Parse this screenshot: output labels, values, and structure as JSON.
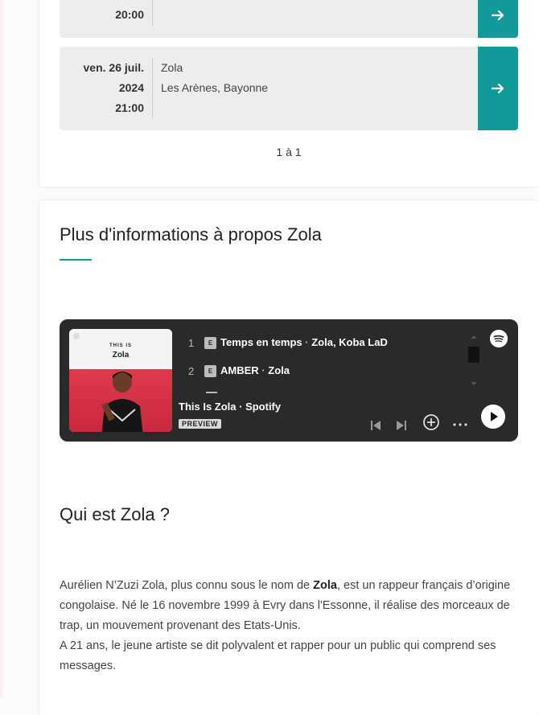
{
  "events": [
    {
      "date_line1": "",
      "date_line2": "",
      "time": "20:00",
      "artist": "",
      "venue": "",
      "arrow_icon": "arrow-right-icon"
    },
    {
      "date_line1": "ven. 26 juil.",
      "date_line2": "2024",
      "time": "21:00",
      "artist": "Zola",
      "venue": "Les Arènes, Bayonne",
      "arrow_icon": "arrow-right-icon"
    }
  ],
  "pagination": {
    "label": "1 à 1"
  },
  "info_section": {
    "title": "Plus d'informations à propos Zola"
  },
  "spotify": {
    "cover_small_text": "THIS IS",
    "cover_name": "Zola",
    "tracks": [
      {
        "number": "1",
        "explicit": "E",
        "title": "Temps en temps",
        "artists": "Zola, Koba LaD"
      },
      {
        "number": "2",
        "explicit": "E",
        "title": "AMBER",
        "artists": "Zola"
      }
    ],
    "separator": "·",
    "playlist_title": "This Is Zola · Spotify",
    "preview_label": "PREVIEW",
    "accent": "#12999a"
  },
  "bio_section": {
    "title": "Qui est Zola ?",
    "p1_before": "Aurélien N’Zuzi Zola, plus connu sous le nom de ",
    "p1_bold": "Zola",
    "p1_after": ", est un rappeur français d’origine congolaise. Né le 16 novembre 1999 à Evry dans l'Essonne, il réalise des morceaux de trap, un mouvement provenant des Etats-Unis.",
    "p2": "A 21 ans, le jeune artiste se dit polyvalent et rapper pour un public qui comprend ses messages."
  }
}
